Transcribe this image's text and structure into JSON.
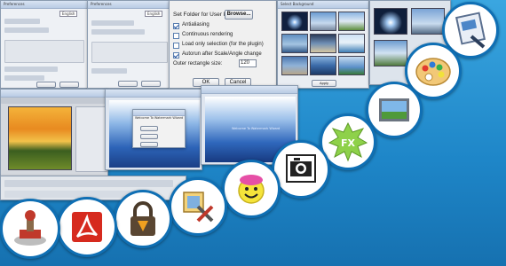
{
  "presets_dialog": {
    "label": "Set Folder for User Presets",
    "browse": "Browse...",
    "options": [
      {
        "label": "Antialiasing",
        "checked": true
      },
      {
        "label": "Continuous rendering",
        "checked": false
      },
      {
        "label": "Load only selection (for the plugin)",
        "checked": false
      },
      {
        "label": "Autorun after Scale/Angle change",
        "checked": true
      }
    ],
    "outer_label": "Outer rectangle size:",
    "outer_value": "120",
    "ok": "OK",
    "cancel": "Cancel"
  },
  "preferences_windows": [
    {
      "title": "Preferences",
      "language": "English"
    },
    {
      "title": "Preferences",
      "language": "English"
    }
  ],
  "select_background": {
    "title": "Select Background",
    "button": "Apply"
  },
  "watermark_dialog": {
    "title": "Welcome To Watermark Wizard",
    "label": "Welcome To Watermark Wizard"
  },
  "app_icons": [
    {
      "name": "magnifier-document-icon"
    },
    {
      "name": "paint-palette-icon"
    },
    {
      "name": "picture-frame-icon"
    },
    {
      "name": "fx-star-icon"
    },
    {
      "name": "camera-icon"
    },
    {
      "name": "smiley-face-icon"
    },
    {
      "name": "crop-tools-icon"
    },
    {
      "name": "vlc-lock-icon"
    },
    {
      "name": "pdf-reader-icon"
    },
    {
      "name": "rubber-stamp-icon"
    }
  ],
  "colors": {
    "background": "#1f86c6",
    "circle_border": "#0f6fb4"
  }
}
